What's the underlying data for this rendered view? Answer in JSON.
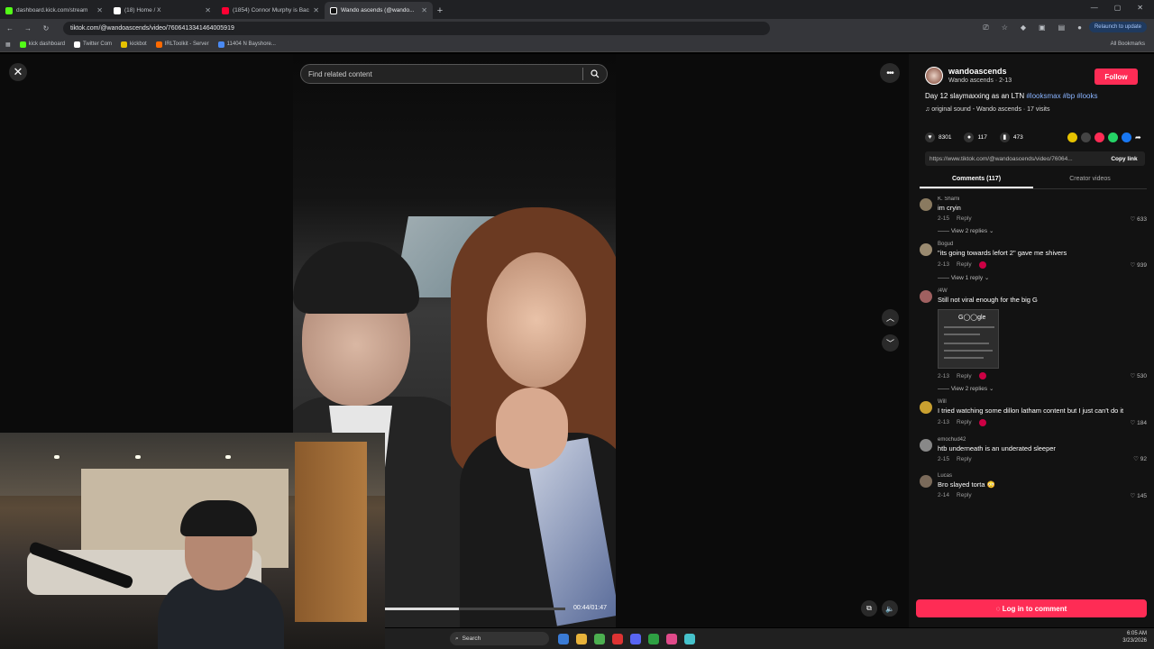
{
  "browser": {
    "tabs": [
      {
        "title": "dashboard.kick.com/stream",
        "color": "#53fc18",
        "active": false
      },
      {
        "title": "(18) Home / X",
        "color": "#ffffff",
        "active": false
      },
      {
        "title": "(1854) Connor Murphy is Back...",
        "color": "#ff0033",
        "active": false
      },
      {
        "title": "Wando ascends (@wando...",
        "color": "#ffffff",
        "active": true
      }
    ],
    "url": "tiktok.com/@wandoascends/video/7606413341464005919",
    "relaunch_label": "Relaunch to update",
    "bookmarks": [
      {
        "label": "kick dashboard",
        "color": "#53fc18"
      },
      {
        "label": "Twitter Com",
        "color": "#ffffff"
      },
      {
        "label": "kickbot",
        "color": "#e6c200"
      },
      {
        "label": "IRLToolkit - Server",
        "color": "#ff6a00"
      },
      {
        "label": "11404 N Bayshore...",
        "color": "#4a8af4"
      }
    ],
    "all_bookmarks": "All Bookmarks"
  },
  "player": {
    "search_placeholder": "Find related content",
    "timecode": "00:44/01:47",
    "progress_fraction": 0.41
  },
  "post": {
    "username": "wandoascends",
    "subline": "Wando ascends · 2-13",
    "follow_label": "Follow",
    "caption_text": "Day 12 slaymaxxing as an LTN ",
    "hashtags": "#looksmax #bp #looks",
    "sound": "original sound - Wando ascends · 17 visits",
    "likes": "8301",
    "comments_count": "117",
    "saves": "473",
    "link": "https://www.tiktok.com/@wandoascends/video/76064...",
    "copy_label": "Copy link",
    "tab_comments": "Comments (117)",
    "tab_creator": "Creator videos",
    "login_label": "Log in to comment"
  },
  "comments": [
    {
      "user": "K. Shami",
      "text": "im cryin",
      "date": "2-15",
      "reply": "Reply",
      "likes": "633",
      "replies": "View 2 replies"
    },
    {
      "user": "Bogud",
      "text": "\"its going towards lefort 2\" gave me shivers",
      "date": "2-13",
      "reply": "Reply",
      "likes": "939",
      "replies": "View 1 reply"
    },
    {
      "user": "/4W",
      "text": "Still not viral enough for the big G",
      "date": "2-13",
      "reply": "Reply",
      "likes": "530",
      "replies": "View 2 replies"
    },
    {
      "user": "Will",
      "text": "I tried watching some dillon latham content but I just can't do it",
      "date": "2-13",
      "reply": "Reply",
      "likes": "184",
      "replies": ""
    },
    {
      "user": "emochud42",
      "text": "htb underneath is an underated sleeper",
      "date": "2-15",
      "reply": "Reply",
      "likes": "92",
      "replies": ""
    },
    {
      "user": "Lucas",
      "text": "Bro slayed torta",
      "date": "2-14",
      "reply": "Reply",
      "likes": "145",
      "replies": ""
    }
  ],
  "taskbar": {
    "search_placeholder": "Search",
    "time": "6:05 AM",
    "date": "3/23/2026"
  }
}
